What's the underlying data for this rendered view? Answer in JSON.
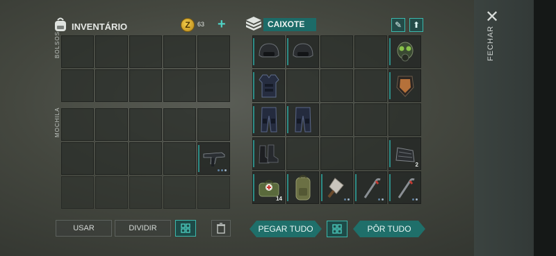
{
  "inventory": {
    "title": "INVENTÁRIO",
    "pockets_label": "BOLSOS",
    "backpack_label": "MOCHILA",
    "coin_icon": "coin-icon",
    "coin_count": "63",
    "add_label": "+"
  },
  "crate": {
    "title": "CAIXOTE",
    "items": [
      {
        "name": "helmet",
        "qty": ""
      },
      {
        "name": "helmet",
        "qty": ""
      },
      {
        "name": "gas-mask",
        "qty": ""
      },
      {
        "name": "body-armor",
        "qty": ""
      },
      {
        "name": "armor-plate",
        "qty": ""
      },
      {
        "name": "armored-pants",
        "qty": ""
      },
      {
        "name": "armored-pants",
        "qty": ""
      },
      {
        "name": "boots",
        "qty": ""
      },
      {
        "name": "scrap-metal",
        "qty": "2"
      },
      {
        "name": "medkit-bag",
        "qty": "14"
      },
      {
        "name": "backpack",
        "qty": ""
      },
      {
        "name": "cleaver",
        "qty": ""
      },
      {
        "name": "crowbar",
        "qty": ""
      },
      {
        "name": "crowbar",
        "qty": ""
      }
    ]
  },
  "backpack_items": [
    {
      "name": "uzi",
      "qty": ""
    }
  ],
  "buttons": {
    "use": "USAR",
    "split": "DIVIDIR",
    "take_all": "PEGAR TUDO",
    "put_all": "PÔR TUDO",
    "close": "FECHAR"
  },
  "colors": {
    "accent": "#2e8d87",
    "button": "#1f6f6a",
    "coin": "#f3cc4a"
  }
}
